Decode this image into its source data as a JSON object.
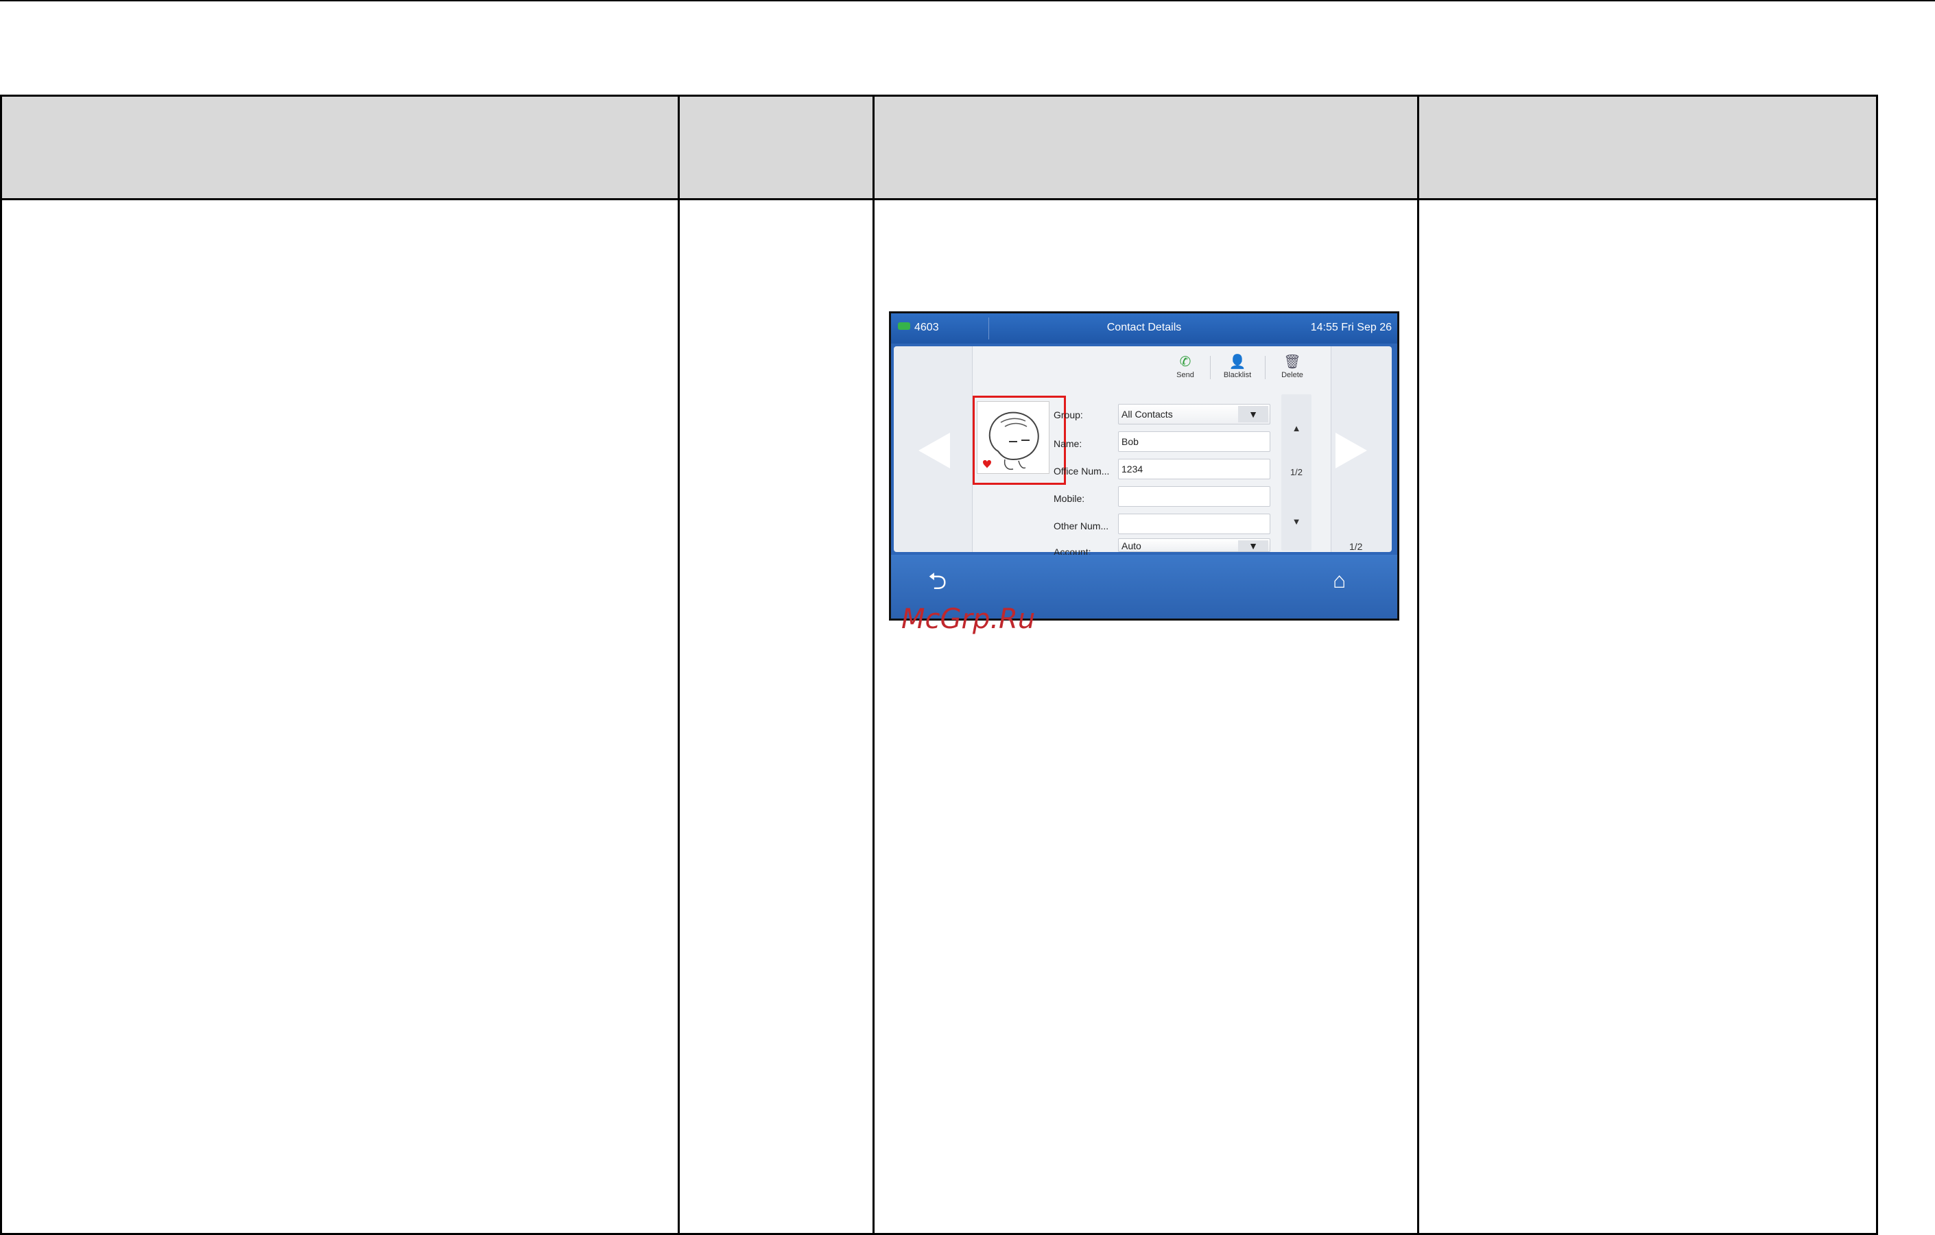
{
  "phone": {
    "status_bar": {
      "account": "4603",
      "title": "Contact Details",
      "clock": "14:55 Fri Sep 26"
    },
    "actions": [
      {
        "label": "Send",
        "icon": "phone-icon"
      },
      {
        "label": "Blacklist",
        "icon": "blacklist-user-icon"
      },
      {
        "label": "Delete",
        "icon": "trash-icon"
      }
    ],
    "fields": {
      "group": {
        "label": "Group:",
        "value": "All Contacts"
      },
      "name": {
        "label": "Name:",
        "value": "Bob"
      },
      "office": {
        "label": "Office Num...",
        "value": "1234"
      },
      "mobile": {
        "label": "Mobile:",
        "value": ""
      },
      "other": {
        "label": "Other Num...",
        "value": ""
      },
      "account": {
        "label": "Account:",
        "value": "Auto"
      }
    },
    "scroll": {
      "up": "▲",
      "page": "1/2",
      "down": "▼"
    },
    "page_total": "1/2",
    "nav": {
      "back_icon": "back-arrow-icon",
      "home_icon": "home-icon"
    },
    "highlight_color": "#e11b1b"
  },
  "watermark": "McGrp.Ru",
  "colors": {
    "header_fill": "#d9d9d9",
    "phone_blue": "#2e66b8",
    "watermark": "#c0282d"
  }
}
